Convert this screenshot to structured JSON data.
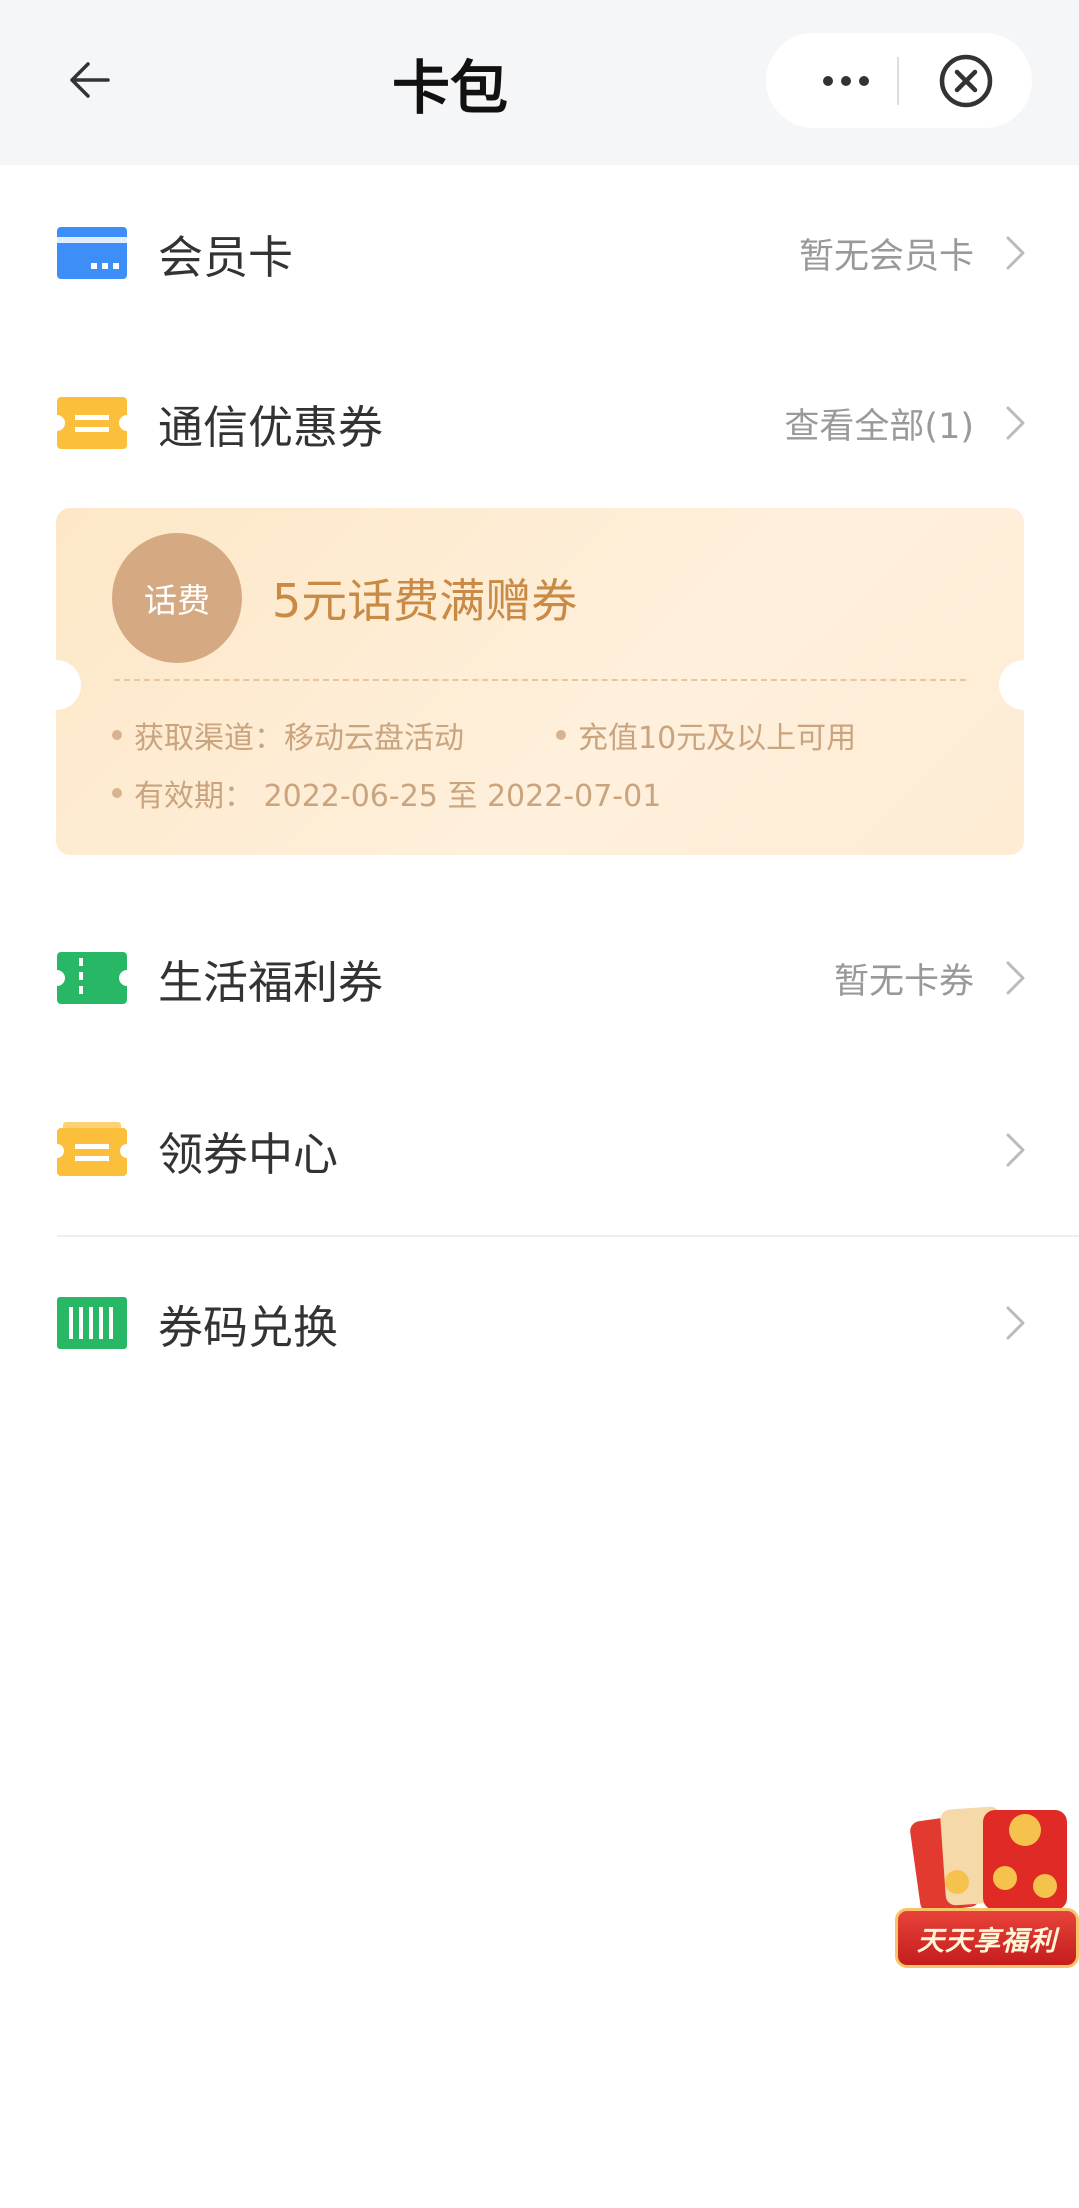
{
  "header": {
    "title": "卡包",
    "back_icon": "arrow-left-icon",
    "more_icon": "more-dots-icon",
    "close_icon": "close-circle-icon"
  },
  "rows": {
    "member_card": {
      "label": "会员卡",
      "value": "暂无会员卡",
      "icon": "card-icon",
      "icon_color": "#3e8ef7"
    },
    "telecom": {
      "label": "通信优惠券",
      "value": "查看全部(1)",
      "icon": "ticket-icon",
      "icon_color": "#fbbf3c"
    },
    "life": {
      "label": "生活福利券",
      "value": "暂无卡券",
      "icon": "ticket-icon",
      "icon_color": "#27b765"
    },
    "center": {
      "label": "领券中心",
      "value": "",
      "icon": "ticket-icon",
      "icon_color": "#fbbf3c"
    },
    "redeem": {
      "label": "券码兑换",
      "value": "",
      "icon": "barcode-icon",
      "icon_color": "#27b765"
    }
  },
  "coupon": {
    "badge": "话费",
    "title": "5元话费满赠券",
    "channel": "获取渠道：移动云盘活动",
    "condition": "充值10元及以上可用",
    "validity": "有效期： 2022-06-25 至 2022-07-01"
  },
  "promo": {
    "text": "天天享福利"
  },
  "colors": {
    "header_bg": "#f5f6f8",
    "coupon_title": "#c98a45",
    "badge_bg": "#d5aa82"
  }
}
